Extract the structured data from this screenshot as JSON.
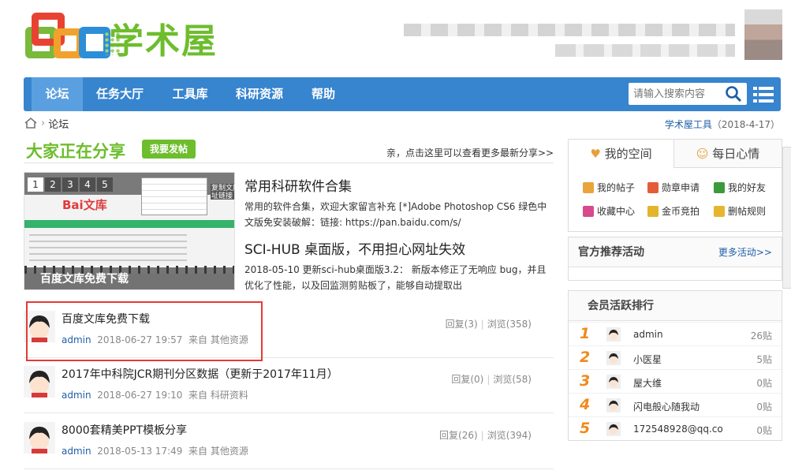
{
  "header": {
    "logo_text": "学术屋"
  },
  "nav": {
    "items": [
      {
        "label": "论坛",
        "active": true
      },
      {
        "label": "任务大厅",
        "active": false
      },
      {
        "label": "工具库",
        "active": false
      },
      {
        "label": "科研资源",
        "active": false
      },
      {
        "label": "帮助",
        "active": false
      }
    ],
    "search_placeholder": "请输入搜索内容"
  },
  "breadcrumb": {
    "current": "论坛",
    "right_link": "学术屋工具",
    "right_date": "（2018-4-17）"
  },
  "share": {
    "title": "大家正在分享",
    "post_button": "我要发帖",
    "more_link": "亲，点击这里可以查看更多最新分享>>"
  },
  "slideshow": {
    "pages": [
      "1",
      "2",
      "3",
      "4",
      "5"
    ],
    "current": "1",
    "caption": "百度文库免费下载",
    "screenshot_text": {
      "brand": "Bai文库",
      "tooltip": "复制文库网址链接"
    }
  },
  "featured": [
    {
      "title": "常用科研软件合集",
      "desc": "常用的软件合集，欢迎大家留言补充 [*]Adobe Photoshop CS6 绿色中文版免安装破解：链接: https://pan.baidu.com/s/"
    },
    {
      "title": "SCI-HUB 桌面版，不用担心网址失效",
      "desc": "2018-05-10 更新sci-hub桌面版3.2： 新版本修正了无响应 bug，并且优化了性能，以及回监测剪贴板了，能够自动提取出"
    }
  ],
  "threads": [
    {
      "title": "百度文库免费下载",
      "user": "admin",
      "date": "2018-06-27 19:57",
      "from": "来自 其他资源",
      "replies": "回复(3)",
      "views": "浏览(358)"
    },
    {
      "title": "2017年中科院JCR期刊分区数据（更新于2017年11月）",
      "user": "admin",
      "date": "2018-06-27 19:10",
      "from": "来自 科研资料",
      "replies": "回复(0)",
      "views": "浏览(58)"
    },
    {
      "title": "8000套精美PPT模板分享",
      "user": "admin",
      "date": "2018-05-13 17:49",
      "from": "来自 其他资源",
      "replies": "回复(26)",
      "views": "浏览(394)"
    }
  ],
  "sidebar": {
    "tabs": [
      {
        "label": "我的空间",
        "icon": "heart-icon"
      },
      {
        "label": "每日心情",
        "icon": "smile-icon"
      }
    ],
    "quick_links": [
      {
        "label": "我的帖子",
        "color": "#e9a53b"
      },
      {
        "label": "勋章申请",
        "color": "#e45c3a"
      },
      {
        "label": "我的好友",
        "color": "#3c9a3c"
      },
      {
        "label": "收藏中心",
        "color": "#d94a8c"
      },
      {
        "label": "金币竞拍",
        "color": "#e2b52b"
      },
      {
        "label": "删帖规则",
        "color": "#e6b62e"
      }
    ],
    "recommend": {
      "title": "官方推荐活动",
      "more": "更多活动>>"
    },
    "ranking": {
      "title": "会员活跃排行",
      "rows": [
        {
          "rank": "1",
          "name": "admin",
          "count": "26贴"
        },
        {
          "rank": "2",
          "name": "小医星",
          "count": "5贴"
        },
        {
          "rank": "3",
          "name": "屋大维",
          "count": "0贴"
        },
        {
          "rank": "4",
          "name": "闪电般心随我动",
          "count": "0贴"
        },
        {
          "rank": "5",
          "name": "172548928@qq.co",
          "count": "0贴"
        }
      ]
    }
  },
  "colors": {
    "nav_blue": "#3784cf",
    "brand_green": "#6dbd2d",
    "link_blue": "#1f5fa8",
    "rank_orange": "#f08a1d",
    "highlight_red": "#e53935"
  }
}
